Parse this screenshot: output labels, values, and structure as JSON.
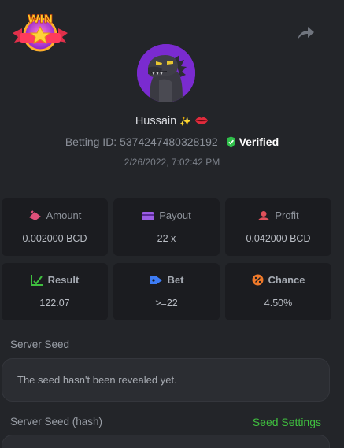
{
  "badge": {
    "text": "WIN"
  },
  "player": {
    "name": "Hussain",
    "name_emoji": "✨",
    "bet_id_label": "Betting ID:",
    "bet_id": "5374247480328192",
    "verified_label": "Verified",
    "datetime": "2/26/2022, 7:02:42 PM"
  },
  "stats": {
    "amount": {
      "label": "Amount",
      "value": "0.002000 BCD"
    },
    "payout": {
      "label": "Payout",
      "value": "22 x"
    },
    "profit": {
      "label": "Profit",
      "value": "0.042000 BCD"
    },
    "result": {
      "label": "Result",
      "value": "122.07"
    },
    "bet": {
      "label": "Bet",
      "value": ">=22"
    },
    "chance": {
      "label": "Chance",
      "value": "4.50%"
    }
  },
  "server_seed": {
    "label": "Server Seed",
    "value": "The seed hasn't been revealed yet."
  },
  "server_seed_hash": {
    "label": "Server Seed (hash)",
    "settings_link": "Seed Settings"
  },
  "colors": {
    "background": "#232529",
    "card": "#1b1c20",
    "accent_green": "#3fbf3f",
    "amount_icon": "#e0507a",
    "payout_icon": "#9b5de5",
    "profit_icon": "#e0505a",
    "result_icon": "#3fbf3f",
    "bet_icon": "#3d7cf5",
    "chance_icon": "#f07a2a"
  },
  "icons": {
    "share": "share-arrow-icon",
    "verified": "shield-check-icon",
    "amount": "money-icon",
    "payout": "wallet-icon",
    "profit": "profit-icon",
    "result": "chart-check-icon",
    "bet": "tag-icon",
    "chance": "percent-icon"
  }
}
